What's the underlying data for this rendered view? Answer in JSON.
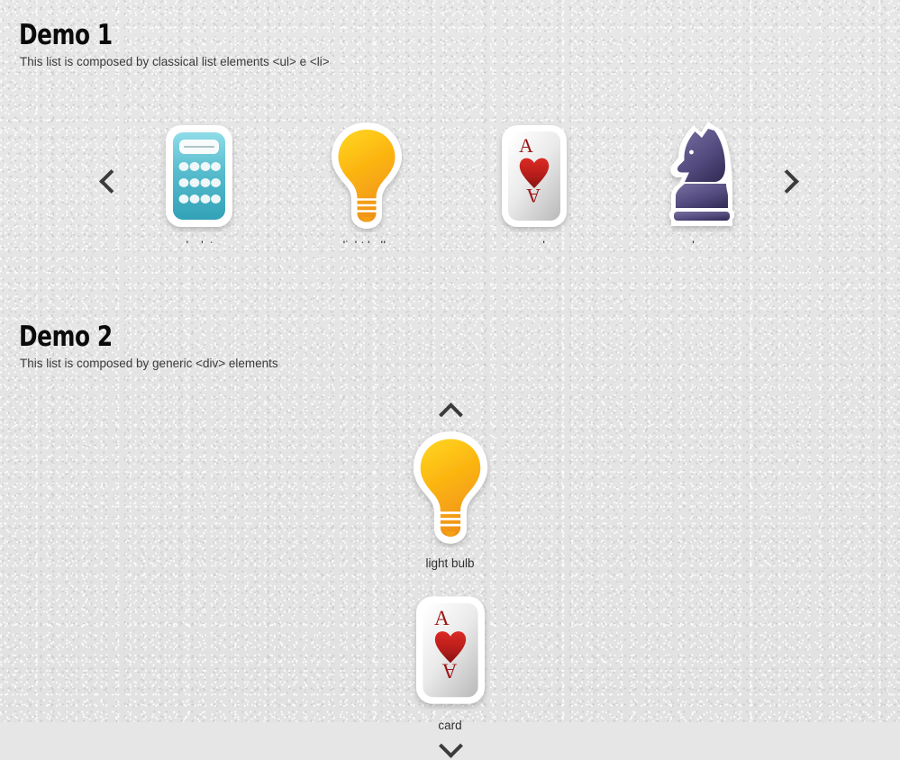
{
  "page": {
    "background_color": "#e5e5e5",
    "text_color": "#3a3a3a"
  },
  "demo1": {
    "title": "Demo 1",
    "subtitle": "This list is composed by classical list elements <ul> e <li>",
    "prev_arrow_icon": "chevron-left-icon",
    "next_arrow_icon": "chevron-right-icon",
    "items": [
      {
        "icon": "calculator-icon",
        "label": "calculator",
        "color": "#4bb7c9"
      },
      {
        "icon": "light-bulb-icon",
        "label": "light bulb",
        "color": "#f5a623"
      },
      {
        "icon": "playing-card-icon",
        "label": "card",
        "color": "#b02020"
      },
      {
        "icon": "chess-knight-icon",
        "label": "chess",
        "color": "#564f85"
      }
    ]
  },
  "demo2": {
    "title": "Demo 2",
    "subtitle": "This list is composed by generic <div> elements",
    "up_arrow_icon": "chevron-up-icon",
    "down_arrow_icon": "chevron-down-icon",
    "items": [
      {
        "icon": "light-bulb-icon",
        "label": "light bulb",
        "color": "#f5a623"
      },
      {
        "icon": "playing-card-icon",
        "label": "card",
        "color": "#b02020"
      }
    ]
  },
  "colors": {
    "calculator_light": "#8ddbe6",
    "calculator_dark": "#34a3b8",
    "bulb_light": "#ffc91e",
    "bulb_dark": "#f08a14",
    "heart_light": "#d92626",
    "heart_dark": "#8a1616",
    "card_light": "#fbfbfb",
    "card_dark": "#bfbfbf",
    "knight_light": "#6b6391",
    "knight_dark": "#3c3460",
    "arrow": "#3b3b3b",
    "sticker_outline": "#ffffff"
  }
}
